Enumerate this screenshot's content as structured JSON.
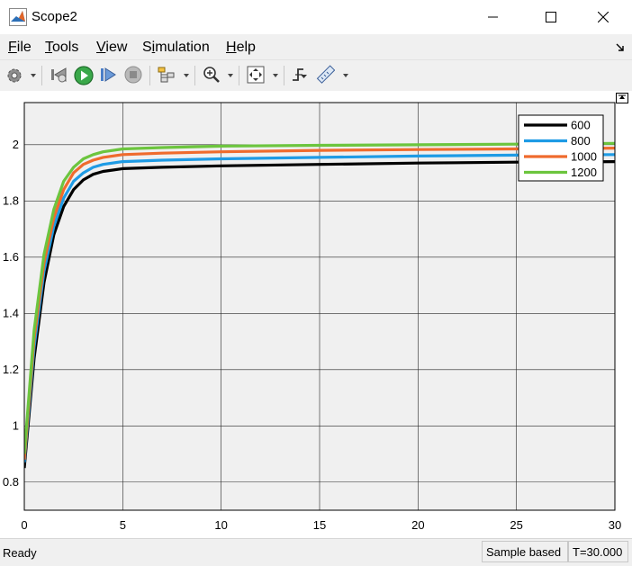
{
  "window": {
    "title": "Scope2"
  },
  "menu": [
    "File",
    "Tools",
    "View",
    "Simulation",
    "Help"
  ],
  "menu_mnemonic_index": [
    0,
    0,
    0,
    1,
    0
  ],
  "status": {
    "ready": "Ready",
    "mode": "Sample based",
    "time": "T=30.000"
  },
  "colors": {
    "line_600": "#000000",
    "line_800": "#1e9be5",
    "line_1000": "#ef6b2d",
    "line_1200": "#6cc53e",
    "plot_bg": "#f0f0f0",
    "grid": "#262626"
  },
  "chart_data": {
    "type": "line",
    "title": "",
    "xlabel": "",
    "ylabel": "",
    "xlim": [
      0,
      30
    ],
    "ylim": [
      0.7,
      2.15
    ],
    "xticks": [
      "0",
      "5",
      "10",
      "15",
      "20",
      "25",
      "30"
    ],
    "yticks": [
      "0.8",
      "1",
      "1.2",
      "1.4",
      "1.6",
      "1.8",
      "2"
    ],
    "grid": true,
    "legend_position": "top-right",
    "x": [
      0,
      0.5,
      1,
      1.5,
      2,
      2.5,
      3,
      3.5,
      4,
      5,
      7,
      10,
      15,
      20,
      25,
      30
    ],
    "series": [
      {
        "name": "600",
        "values": [
          0.85,
          1.24,
          1.51,
          1.68,
          1.78,
          1.84,
          1.875,
          1.895,
          1.905,
          1.915,
          1.92,
          1.925,
          1.93,
          1.935,
          1.938,
          1.94
        ]
      },
      {
        "name": "800",
        "values": [
          0.87,
          1.28,
          1.55,
          1.71,
          1.81,
          1.87,
          1.9,
          1.92,
          1.93,
          1.94,
          1.945,
          1.95,
          1.955,
          1.96,
          1.963,
          1.965
        ]
      },
      {
        "name": "1000",
        "values": [
          0.88,
          1.31,
          1.58,
          1.74,
          1.84,
          1.9,
          1.93,
          1.945,
          1.955,
          1.965,
          1.97,
          1.975,
          1.98,
          1.983,
          1.985,
          1.988
        ]
      },
      {
        "name": "1200",
        "values": [
          0.9,
          1.34,
          1.61,
          1.77,
          1.87,
          1.92,
          1.95,
          1.965,
          1.975,
          1.985,
          1.99,
          1.995,
          1.998,
          2.0,
          2.002,
          2.005
        ]
      }
    ]
  }
}
